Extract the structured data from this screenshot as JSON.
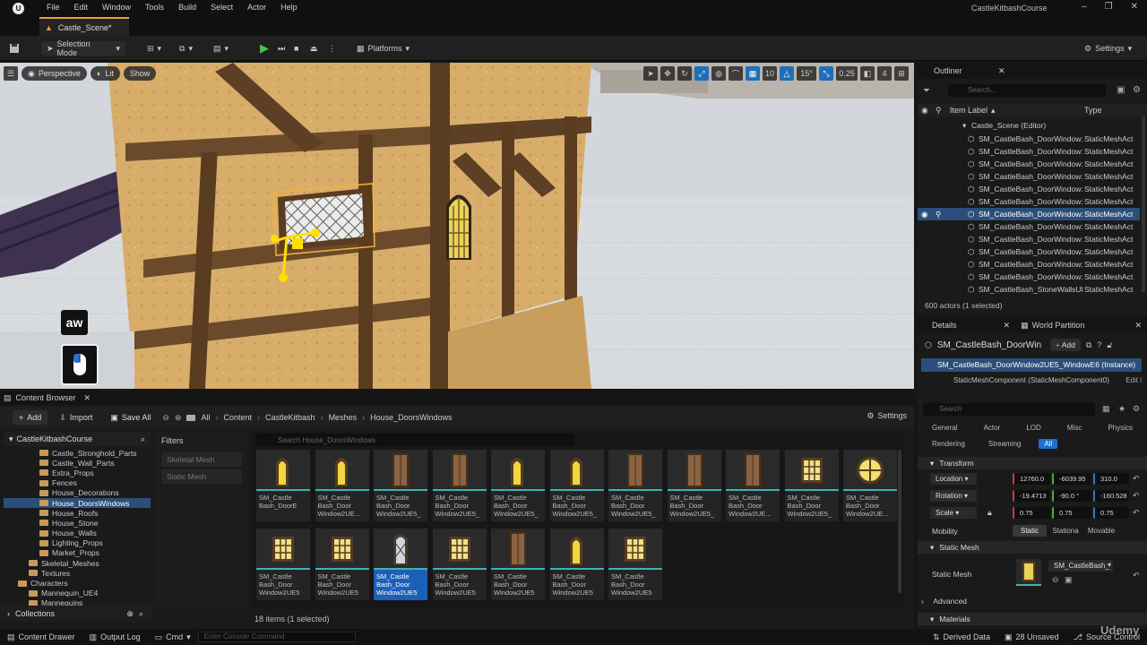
{
  "app": {
    "logo": "U",
    "menus": [
      "File",
      "Edit",
      "Window",
      "Tools",
      "Build",
      "Select",
      "Actor",
      "Help"
    ],
    "project": "CastleKitbashCourse",
    "window_controls": [
      "–",
      "❐",
      "✕"
    ],
    "tab": "Castle_Scene*"
  },
  "toolbar": {
    "selection_mode": "Selection Mode",
    "platforms": "Platforms",
    "settings": "Settings"
  },
  "viewport": {
    "perspective": "Perspective",
    "lit": "Lit",
    "show": "Show",
    "grid_snap": "10",
    "rotation_snap": "15°",
    "scale_snap": "0.25",
    "camera_speed": "4",
    "overlay_key": "aw"
  },
  "content_browser": {
    "tab": "Content Browser",
    "add": "Add",
    "import": "Import",
    "save_all": "Save All",
    "breadcrumbs": [
      "All",
      "Content",
      "CastleKitbash",
      "Meshes",
      "House_DoorsWindows"
    ],
    "settings": "Settings",
    "root": "CastleKitbashCourse",
    "tree": [
      {
        "label": "Castle_Stronghold_Parts",
        "depth": 3,
        "selected": false
      },
      {
        "label": "Castle_Wall_Parts",
        "depth": 3,
        "selected": false
      },
      {
        "label": "Extra_Props",
        "depth": 3,
        "selected": false
      },
      {
        "label": "Fences",
        "depth": 3,
        "selected": false
      },
      {
        "label": "House_Decorations",
        "depth": 3,
        "selected": false
      },
      {
        "label": "House_DoorsWindows",
        "depth": 3,
        "selected": true
      },
      {
        "label": "House_Roofs",
        "depth": 3,
        "selected": false
      },
      {
        "label": "House_Stone",
        "depth": 3,
        "selected": false
      },
      {
        "label": "House_Walls",
        "depth": 3,
        "selected": false
      },
      {
        "label": "Lighting_Props",
        "depth": 3,
        "selected": false
      },
      {
        "label": "Market_Props",
        "depth": 3,
        "selected": false
      },
      {
        "label": "Skeletal_Meshes",
        "depth": 2,
        "selected": false
      },
      {
        "label": "Textures",
        "depth": 2,
        "selected": false
      },
      {
        "label": "Characters",
        "depth": 1,
        "selected": false
      },
      {
        "label": "Mannequin_UE4",
        "depth": 2,
        "selected": false
      },
      {
        "label": "Mannequins",
        "depth": 2,
        "selected": false
      }
    ],
    "filters_title": "Filters",
    "filters": [
      "Skeletal Mesh",
      "Static Mesh"
    ],
    "search_placeholder": "Search House_DoorsWindows",
    "assets_row1": [
      {
        "label": "SM_Castle Bash_DoorE",
        "kind": "arch"
      },
      {
        "label": "SM_Castle Bash_Door Window2UE...",
        "kind": "arch"
      },
      {
        "label": "SM_Castle Bash_Door Window2UE5_",
        "kind": "door"
      },
      {
        "label": "SM_Castle Bash_Door Window2UE5_",
        "kind": "door"
      },
      {
        "label": "SM_Castle Bash_Door Window2UE5_",
        "kind": "arch"
      },
      {
        "label": "SM_Castle Bash_Door Window2UE5_",
        "kind": "arch"
      },
      {
        "label": "SM_Castle Bash_Door Window2UE5_",
        "kind": "door"
      },
      {
        "label": "SM_Castle Bash_Door Window2UE5_",
        "kind": "door"
      },
      {
        "label": "SM_Castle Bash_Door Window2UE...",
        "kind": "door"
      },
      {
        "label": "SM_Castle Bash_Door Window2UE5_",
        "kind": "window"
      },
      {
        "label": "SM_Castle Bash_Door Window2UE...",
        "kind": "round"
      }
    ],
    "assets_row2": [
      {
        "label": "SM_Castle Bash_Door Window2UE5",
        "kind": "window",
        "selected": false
      },
      {
        "label": "SM_Castle Bash_Door Window2UE5",
        "kind": "window",
        "selected": false
      },
      {
        "label": "SM_Castle Bash_Door Window2UE5",
        "kind": "diamond",
        "selected": true
      },
      {
        "label": "SM_Castle Bash_Door Window2UE5",
        "kind": "window",
        "selected": false
      },
      {
        "label": "SM_Castle Bash_Door Window2UE5",
        "kind": "door",
        "selected": false
      },
      {
        "label": "SM_Castle Bash_Door Window2UE5",
        "kind": "arch",
        "selected": false
      },
      {
        "label": "SM_Castle Bash_Door Window2UE5",
        "kind": "window",
        "selected": false
      }
    ],
    "status": "18 items (1 selected)",
    "collections": "Collections"
  },
  "outliner": {
    "title": "Outliner",
    "search_placeholder": "Search...",
    "col_label": "Item Label",
    "col_type": "Type",
    "scene": "Castle_Scene (Editor)",
    "rows": [
      {
        "label": "SM_CastleBash_DoorWindow:",
        "type": "StaticMeshAct",
        "selected": false
      },
      {
        "label": "SM_CastleBash_DoorWindow:",
        "type": "StaticMeshAct",
        "selected": false
      },
      {
        "label": "SM_CastleBash_DoorWindow:",
        "type": "StaticMeshAct",
        "selected": false
      },
      {
        "label": "SM_CastleBash_DoorWindow:",
        "type": "StaticMeshAct",
        "selected": false
      },
      {
        "label": "SM_CastleBash_DoorWindow:",
        "type": "StaticMeshAct",
        "selected": false
      },
      {
        "label": "SM_CastleBash_DoorWindow:",
        "type": "StaticMeshAct",
        "selected": false
      },
      {
        "label": "SM_CastleBash_DoorWindow:",
        "type": "StaticMeshAct",
        "selected": true
      },
      {
        "label": "SM_CastleBash_DoorWindow:",
        "type": "StaticMeshAct",
        "selected": false
      },
      {
        "label": "SM_CastleBash_DoorWindow:",
        "type": "StaticMeshAct",
        "selected": false
      },
      {
        "label": "SM_CastleBash_DoorWindow:",
        "type": "StaticMeshAct",
        "selected": false
      },
      {
        "label": "SM_CastleBash_DoorWindow:",
        "type": "StaticMeshAct",
        "selected": false
      },
      {
        "label": "SM_CastleBash_DoorWindow:",
        "type": "StaticMeshAct",
        "selected": false
      },
      {
        "label": "SM_CastleBash_StoneWallsUI",
        "type": "StaticMeshAct",
        "selected": false
      }
    ],
    "count": "600 actors (1 selected)"
  },
  "details": {
    "tab": "Details",
    "tab2": "World Partition",
    "actor": "SM_CastleBash_DoorWin",
    "add": "Add",
    "instance": "SM_CastleBash_DoorWindow2UE5_WindowE6 (Instance)",
    "component": "StaticMeshComponent (StaticMeshComponent0)",
    "edit": "Edit i",
    "search_placeholder": "Search",
    "categories_row1": [
      "General",
      "Actor",
      "LOD",
      "Misc",
      "Physics"
    ],
    "categories_row2": [
      "Rendering",
      "Streaming",
      "All"
    ],
    "transform": "Transform",
    "location_label": "Location",
    "location": [
      "12760.0",
      "-6039.95",
      "310.0"
    ],
    "rotation_label": "Rotation",
    "rotation": [
      "-19.4713",
      "-90.0 °",
      "-160.528"
    ],
    "scale_label": "Scale",
    "scale": [
      "0.75",
      "0.75",
      "0.75"
    ],
    "mobility_label": "Mobility",
    "mobility": [
      "Static",
      "Stationa",
      "Movable"
    ],
    "static_mesh_section": "Static Mesh",
    "static_mesh_label": "Static Mesh",
    "static_mesh_value": "SM_CastleBash_",
    "advanced": "Advanced",
    "materials": "Materials"
  },
  "bottom": {
    "content_drawer": "Content Drawer",
    "output_log": "Output Log",
    "cmd": "Cmd",
    "console_placeholder": "Enter Console Command",
    "derived_data": "Derived Data",
    "unsaved": "28 Unsaved",
    "source_control": "Source Control"
  },
  "watermark": "Udemy"
}
